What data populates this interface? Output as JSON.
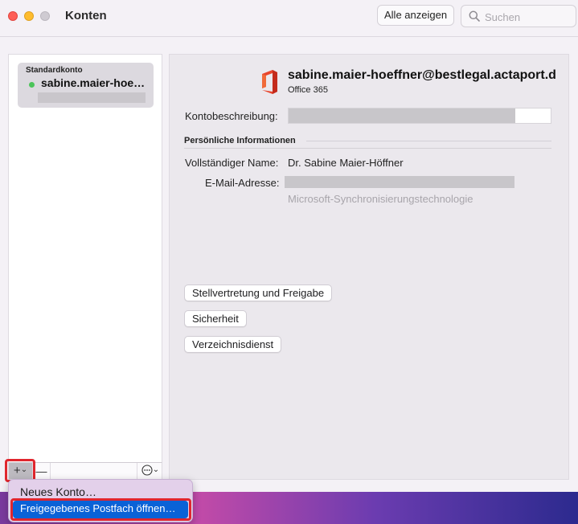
{
  "window": {
    "title": "Konten",
    "show_all_label": "Alle anzeigen",
    "search_placeholder": "Suchen"
  },
  "sidebar": {
    "accounts": [
      {
        "type_label": "Standardkonto",
        "name": "sabine.maier-hoe…",
        "status": "online"
      }
    ],
    "toolbar": {
      "add_symbol": "+",
      "add_chevron": "⌄",
      "remove_symbol": "—",
      "action_symbol": "⋯",
      "action_chevron": "⌄"
    }
  },
  "add_menu": {
    "items": [
      {
        "label": "Neues Konto…"
      },
      {
        "label": "Freigegebenes Postfach öffnen…",
        "selected": true
      }
    ]
  },
  "detail": {
    "email": "sabine.maier-hoeffner@bestlegal.actaport.d",
    "account_kind": "Office 365",
    "description_label": "Kontobeschreibung:",
    "personal_section_title": "Persönliche Informationen",
    "full_name_label": "Vollständiger Name:",
    "full_name_value": "Dr. Sabine Maier-Höffner",
    "email_label": "E-Mail-Adresse:",
    "sync_technology": "Microsoft-Synchronisierungstechnologie",
    "buttons": {
      "delegation": "Stellvertretung und Freigabe",
      "security": "Sicherheit",
      "directory": "Verzeichnisdienst"
    }
  },
  "colors": {
    "accent": "#0a62d7",
    "highlight_red": "#e0262e",
    "status_green": "#4cc45a",
    "office_logo": "#e8452c"
  }
}
